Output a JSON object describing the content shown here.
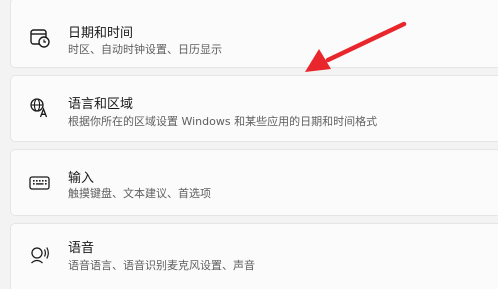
{
  "settings": {
    "items": [
      {
        "title": "日期和时间",
        "subtitle": "时区、自动时钟设置、日历显示",
        "icon": "calendar-clock-icon"
      },
      {
        "title": "语言和区域",
        "subtitle": "根据你所在的区域设置 Windows 和某些应用的日期和时间格式",
        "icon": "language-icon"
      },
      {
        "title": "输入",
        "subtitle": "触摸键盘、文本建议、首选项",
        "icon": "keyboard-icon"
      },
      {
        "title": "语音",
        "subtitle": "语音语言、语音识别麦克风设置、声音",
        "icon": "speech-icon"
      }
    ]
  },
  "annotation": {
    "color": "#e8262b"
  }
}
